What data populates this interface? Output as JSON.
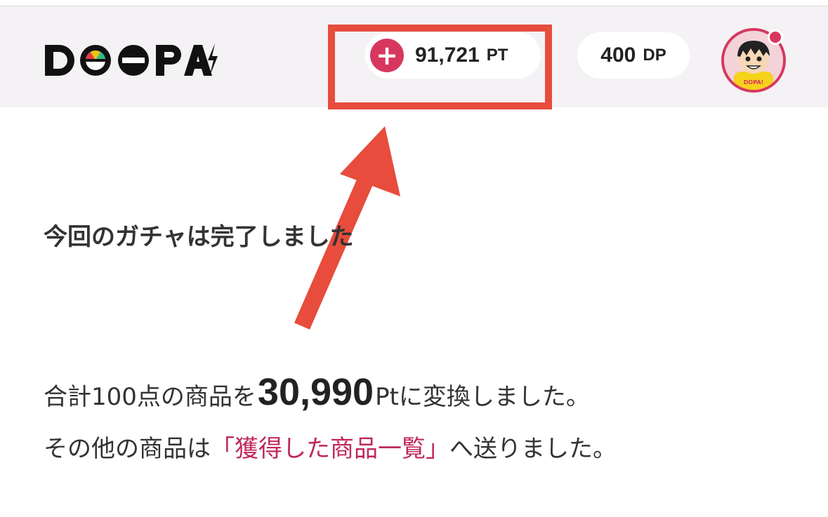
{
  "header": {
    "logo_text": "DOPA!",
    "points": {
      "plus_symbol": "+",
      "value": "91,721",
      "unit": "PT"
    },
    "dp": {
      "value": "400",
      "unit": "DP"
    },
    "avatar_badge_text": "DOPA!"
  },
  "main": {
    "completion_message": "今回のガチャは完了しました",
    "conversion": {
      "prefix": "合計100点の商品を",
      "amount": "30,990",
      "suffix": "Ptに変換しました。"
    },
    "others": {
      "prefix": "その他の商品は",
      "link": "「獲得した商品一覧」",
      "suffix": "へ送りました。"
    }
  },
  "colors": {
    "accent": "#d7375e",
    "annotation": "#e74c3c",
    "link": "#c0285a",
    "header_bg": "#f4f2f5"
  }
}
